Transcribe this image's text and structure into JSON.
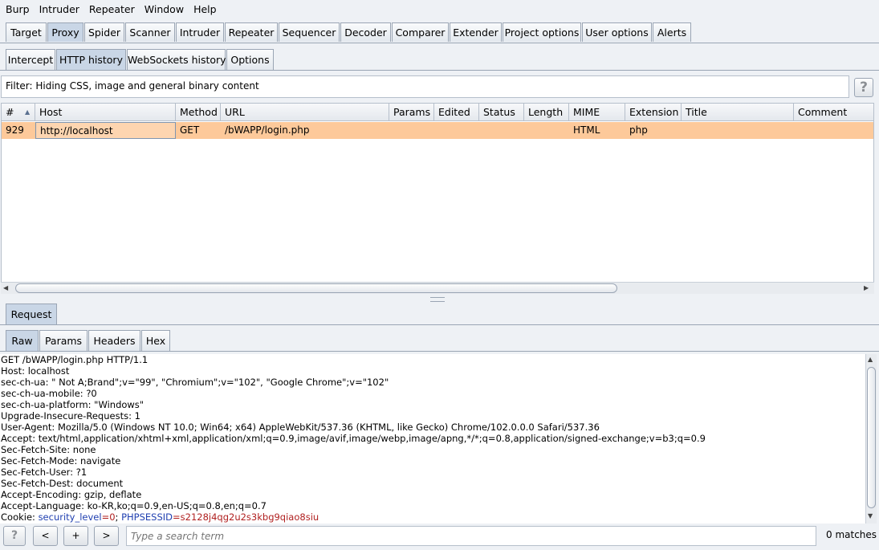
{
  "menu": [
    "Burp",
    "Intruder",
    "Repeater",
    "Window",
    "Help"
  ],
  "main_tabs": [
    "Target",
    "Proxy",
    "Spider",
    "Scanner",
    "Intruder",
    "Repeater",
    "Sequencer",
    "Decoder",
    "Comparer",
    "Extender",
    "Project options",
    "User options",
    "Alerts"
  ],
  "main_active": "Proxy",
  "proxy_tabs": [
    "Intercept",
    "HTTP history",
    "WebSockets history",
    "Options"
  ],
  "proxy_active": "HTTP history",
  "filter_text": "Filter: Hiding CSS, image and general binary content",
  "help_label": "?",
  "sort_indicator": "▲",
  "table": {
    "columns": [
      "#",
      "Host",
      "Method",
      "URL",
      "Params",
      "Edited",
      "Status",
      "Length",
      "MIME type",
      "Extension",
      "Title",
      "Comment"
    ],
    "rows": [
      {
        "num": "929",
        "host": "http://localhost",
        "method": "GET",
        "url": "/bWAPP/login.php",
        "params": "",
        "edited": "",
        "status": "",
        "length": "",
        "mime": "HTML",
        "ext": "php",
        "title": "",
        "comment": ""
      }
    ]
  },
  "request_tab": "Request",
  "view_tabs": [
    "Raw",
    "Params",
    "Headers",
    "Hex"
  ],
  "view_active": "Raw",
  "request_lines": [
    "GET /bWAPP/login.php HTTP/1.1",
    "Host: localhost",
    "sec-ch-ua: \" Not A;Brand\";v=\"99\", \"Chromium\";v=\"102\", \"Google Chrome\";v=\"102\"",
    "sec-ch-ua-mobile: ?0",
    "sec-ch-ua-platform: \"Windows\"",
    "Upgrade-Insecure-Requests: 1",
    "User-Agent: Mozilla/5.0 (Windows NT 10.0; Win64; x64) AppleWebKit/537.36 (KHTML, like Gecko) Chrome/102.0.0.0 Safari/537.36",
    "Accept: text/html,application/xhtml+xml,application/xml;q=0.9,image/avif,image/webp,image/apng,*/*;q=0.8,application/signed-exchange;v=b3;q=0.9",
    "Sec-Fetch-Site: none",
    "Sec-Fetch-Mode: navigate",
    "Sec-Fetch-User: ?1",
    "Sec-Fetch-Dest: document",
    "Accept-Encoding: gzip, deflate",
    "Accept-Language: ko-KR,ko;q=0.9,en-US;q=0.8,en;q=0.7"
  ],
  "cookie": {
    "prefix": "Cookie: ",
    "name1": "security_level",
    "val1": "=0",
    "sep": "; ",
    "name2": "PHPSESSID",
    "val2": "=s2128j4qg2u2s3kbg9qiao8siu"
  },
  "bottom": {
    "help": "?",
    "prev": "<",
    "add": "+",
    "next": ">",
    "search_placeholder": "Type a search term",
    "matches": "0 matches"
  },
  "colors": {
    "selected_row": "#fdc99a",
    "active_tab": "#c9d6e6",
    "cookie_name": "#1f3fb0",
    "cookie_value": "#b02020"
  }
}
